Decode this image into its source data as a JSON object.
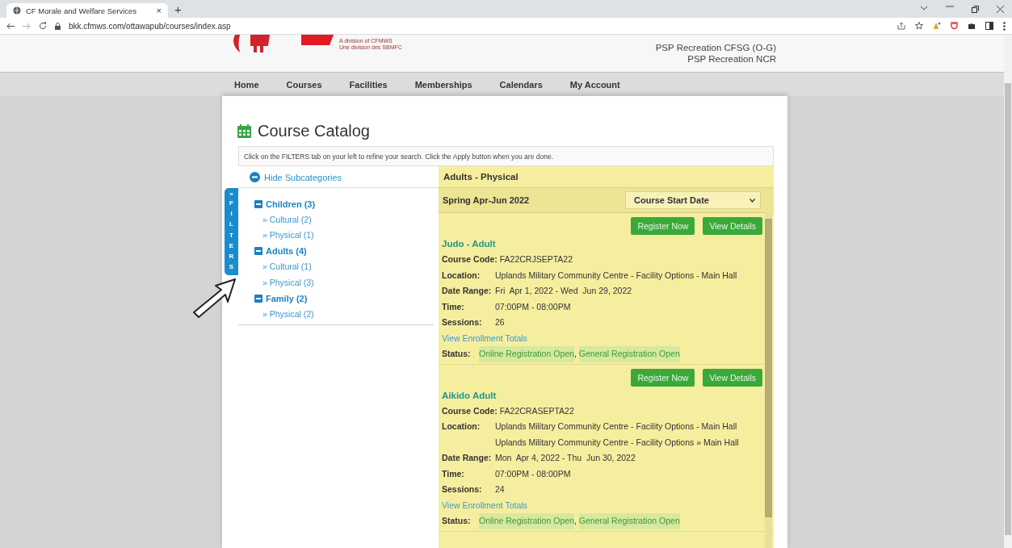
{
  "browser": {
    "tab_title": "CF Morale and Welfare Services",
    "new_tab": "+",
    "tab_close": "×",
    "url": "bkk.cfmws.com/ottawapub/courses/index.asp"
  },
  "header": {
    "logo_caption": [
      "A division of CFMWS",
      "Une division des SBMFC"
    ],
    "lines": [
      "PSP Recreation CFSG (O-G)",
      "PSP Recreation NCR"
    ]
  },
  "nav": [
    "Home",
    "Courses",
    "Facilities",
    "Memberships",
    "Calendars",
    "My Account"
  ],
  "catalog": {
    "title": "Course Catalog",
    "instructions": "Click on the FILTERS tab on your left to refine your search. Click the Apply button when you are done.",
    "hide_subcategories": "Hide Subcategories",
    "filters_tab": {
      "chevron": "»",
      "label": "FILTERS"
    },
    "categories": [
      {
        "label": "Children (3)",
        "expanded": true,
        "children": [
          {
            "label": "» Cultural (2)"
          },
          {
            "label": "» Physical (1)"
          }
        ]
      },
      {
        "label": "Adults (4)",
        "expanded": true,
        "children": [
          {
            "label": "» Cultural (1)"
          },
          {
            "label": "» Physical (3)"
          }
        ]
      },
      {
        "label": "Family (2)",
        "expanded": true,
        "children": [
          {
            "label": "» Physical (2)"
          }
        ]
      }
    ]
  },
  "results": {
    "heading": "Adults - Physical",
    "season": "Spring Apr-Jun 2022",
    "sort": {
      "value": "Course Start Date"
    },
    "courses": [
      {
        "buttons": [
          "Register Now",
          "View Details"
        ],
        "title": "Judo - Adult",
        "code_label": "Course Code:",
        "code": "FA22CRJSEPTA22",
        "fields": [
          {
            "label": "Location:",
            "values": [
              "Uplands Military Community Centre - Facility Options - Main Hall"
            ]
          },
          {
            "label": "Date Range:",
            "values": [
              "Fri  Apr 1, 2022 - Wed  Jun 29, 2022"
            ]
          },
          {
            "label": "Time:",
            "values": [
              "07:00PM - 08:00PM"
            ]
          },
          {
            "label": "Sessions:",
            "values": [
              "26"
            ]
          }
        ],
        "enrollment_link": "View Enrollment Totals",
        "status_label": "Status:",
        "status_separator": ",",
        "statuses": [
          "Online Registration Open",
          "General Registration Open"
        ]
      },
      {
        "buttons": [
          "Register Now",
          "View Details"
        ],
        "title": "Aikido Adult",
        "code_label": "Course Code:",
        "code": "FA22CRASEPTA22",
        "fields": [
          {
            "label": "Location:",
            "values": [
              "Uplands Military Community Centre - Facility Options - Main Hall",
              "Uplands Military Community Centre - Facility Options » Main Hall"
            ]
          },
          {
            "label": "Date Range:",
            "values": [
              "Mon  Apr 4, 2022 - Thu  Jun 30, 2022"
            ]
          },
          {
            "label": "Time:",
            "values": [
              "07:00PM - 08:00PM"
            ]
          },
          {
            "label": "Sessions:",
            "values": [
              "24"
            ]
          }
        ],
        "enrollment_link": "View Enrollment Totals",
        "status_label": "Status:",
        "status_separator": ",",
        "statuses": [
          "Online Registration Open",
          "General Registration Open"
        ]
      }
    ]
  }
}
